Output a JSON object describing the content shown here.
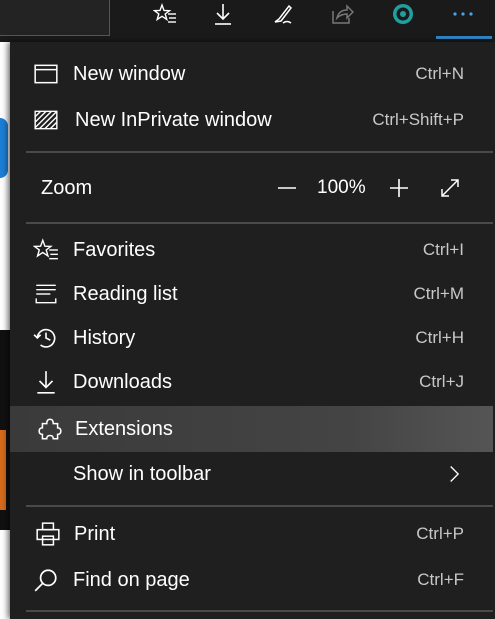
{
  "toolbar": {
    "icons": [
      "favorites-star-icon",
      "download-icon",
      "pen-icon",
      "share-icon",
      "extension-circle-icon",
      "more-icon"
    ]
  },
  "menu": {
    "new_window": {
      "label": "New window",
      "shortcut": "Ctrl+N",
      "icon": "window-icon"
    },
    "new_inprivate": {
      "label": "New InPrivate window",
      "shortcut": "Ctrl+Shift+P",
      "icon": "inprivate-icon"
    },
    "zoom": {
      "label": "Zoom",
      "value": "100%"
    },
    "favorites": {
      "label": "Favorites",
      "shortcut": "Ctrl+I",
      "icon": "favorites-icon"
    },
    "reading_list": {
      "label": "Reading list",
      "shortcut": "Ctrl+M",
      "icon": "reading-list-icon"
    },
    "history": {
      "label": "History",
      "shortcut": "Ctrl+H",
      "icon": "history-icon"
    },
    "downloads": {
      "label": "Downloads",
      "shortcut": "Ctrl+J",
      "icon": "downloads-icon"
    },
    "extensions": {
      "label": "Extensions",
      "icon": "puzzle-icon"
    },
    "show_in_toolbar": {
      "label": "Show in toolbar"
    },
    "print": {
      "label": "Print",
      "shortcut": "Ctrl+P",
      "icon": "print-icon"
    },
    "find_on_page": {
      "label": "Find on page",
      "shortcut": "Ctrl+F",
      "icon": "search-icon"
    }
  },
  "colors": {
    "accent": "#2f86c7",
    "menu_bg": "#1f1f1f",
    "highlight": "#444444"
  }
}
